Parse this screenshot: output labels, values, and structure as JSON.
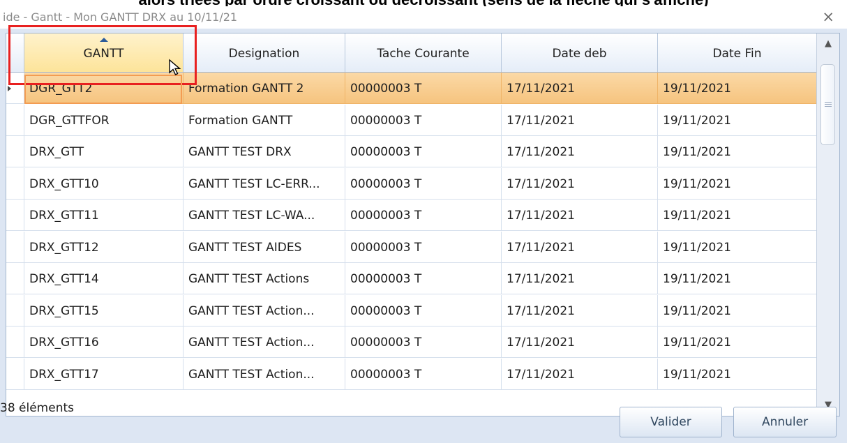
{
  "caption": "alors triées par ordre croissant ou décroissant (sens de la flèche qui s'affiche)",
  "window": {
    "title": "ide - Gantt - Mon GANTT DRX au 10/11/21",
    "close_glyph": "×"
  },
  "grid": {
    "columns": [
      {
        "label": "GANTT",
        "sorted": "ascending"
      },
      {
        "label": "Designation"
      },
      {
        "label": "Tache Courante"
      },
      {
        "label": "Date deb"
      },
      {
        "label": "Date Fin"
      }
    ],
    "rows": [
      {
        "gantt": "DGR_GTT2",
        "designation": "Formation GANTT 2",
        "tache": "00000003 T",
        "date_deb": "17/11/2021",
        "date_fin": "19/11/2021",
        "selected": true
      },
      {
        "gantt": "DGR_GTTFOR",
        "designation": "Formation GANTT",
        "tache": "00000003 T",
        "date_deb": "17/11/2021",
        "date_fin": "19/11/2021"
      },
      {
        "gantt": "DRX_GTT",
        "designation": "GANTT TEST DRX",
        "tache": "00000003 T",
        "date_deb": "17/11/2021",
        "date_fin": "19/11/2021"
      },
      {
        "gantt": "DRX_GTT10",
        "designation": "GANTT TEST LC-ERR...",
        "tache": "00000003 T",
        "date_deb": "17/11/2021",
        "date_fin": "19/11/2021"
      },
      {
        "gantt": "DRX_GTT11",
        "designation": "GANTT TEST LC-WA...",
        "tache": "00000003 T",
        "date_deb": "17/11/2021",
        "date_fin": "19/11/2021"
      },
      {
        "gantt": "DRX_GTT12",
        "designation": "GANTT TEST AIDES",
        "tache": "00000003 T",
        "date_deb": "17/11/2021",
        "date_fin": "19/11/2021"
      },
      {
        "gantt": "DRX_GTT14",
        "designation": "GANTT TEST Actions",
        "tache": "00000003 T",
        "date_deb": "17/11/2021",
        "date_fin": "19/11/2021"
      },
      {
        "gantt": "DRX_GTT15",
        "designation": "GANTT TEST Action...",
        "tache": "00000003 T",
        "date_deb": "17/11/2021",
        "date_fin": "19/11/2021"
      },
      {
        "gantt": "DRX_GTT16",
        "designation": "GANTT TEST Action...",
        "tache": "00000003 T",
        "date_deb": "17/11/2021",
        "date_fin": "19/11/2021"
      },
      {
        "gantt": "DRX_GTT17",
        "designation": "GANTT TEST Action...",
        "tache": "00000003 T",
        "date_deb": "17/11/2021",
        "date_fin": "19/11/2021"
      }
    ],
    "scrollbar": {
      "up_glyph": "▲",
      "down_glyph": "▼"
    }
  },
  "footer": {
    "count_label": "38 éléments",
    "validate_label": "Valider",
    "cancel_label": "Annuler"
  },
  "colors": {
    "selection": "#f8c98a",
    "sorted_header": "#fde49a",
    "highlight_box": "#e82020"
  }
}
